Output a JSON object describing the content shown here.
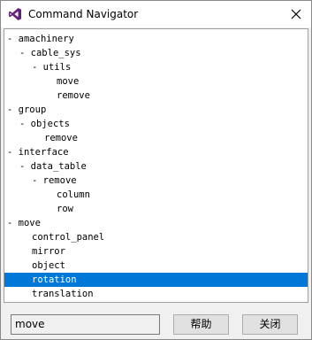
{
  "window": {
    "title": "Command Navigator",
    "app_icon": "visual-studio-icon",
    "close_icon": "close-icon"
  },
  "tree": {
    "rows": [
      {
        "prefix": "- ",
        "label": "amachinery",
        "indent": 0
      },
      {
        "prefix": "- ",
        "label": "cable_sys",
        "indent": 1
      },
      {
        "prefix": "- ",
        "label": "utils",
        "indent": 2
      },
      {
        "prefix": "",
        "label": "move",
        "indent": 4
      },
      {
        "prefix": "",
        "label": "remove",
        "indent": 4
      },
      {
        "prefix": "- ",
        "label": "group",
        "indent": 0
      },
      {
        "prefix": "- ",
        "label": "objects",
        "indent": 1
      },
      {
        "prefix": "",
        "label": "remove",
        "indent": 3
      },
      {
        "prefix": "- ",
        "label": "interface",
        "indent": 0
      },
      {
        "prefix": "- ",
        "label": "data_table",
        "indent": 1
      },
      {
        "prefix": "- ",
        "label": "remove",
        "indent": 2
      },
      {
        "prefix": "",
        "label": "column",
        "indent": 4
      },
      {
        "prefix": "",
        "label": "row",
        "indent": 4
      },
      {
        "prefix": "- ",
        "label": "move",
        "indent": 0
      },
      {
        "prefix": "",
        "label": "control_panel",
        "indent": 2
      },
      {
        "prefix": "",
        "label": "mirror",
        "indent": 2
      },
      {
        "prefix": "",
        "label": "object",
        "indent": 2
      },
      {
        "prefix": "",
        "label": "rotation",
        "indent": 2,
        "selected": true
      },
      {
        "prefix": "",
        "label": "translation",
        "indent": 2
      }
    ]
  },
  "footer": {
    "command_value": "move",
    "help_label": "帮助",
    "close_label": "关闭"
  },
  "colors": {
    "selection": "#0078d7",
    "window_bg": "#f0f0f0",
    "tree_bg": "#ffffff"
  }
}
